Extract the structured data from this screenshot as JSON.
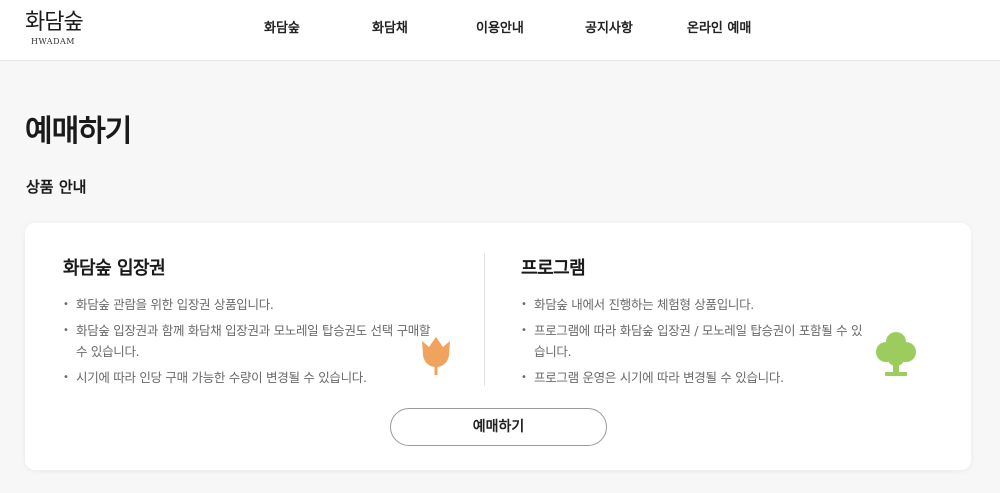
{
  "header": {
    "logo_main": "화담숲",
    "logo_sub": "HWADAM",
    "nav": [
      "화담숲",
      "화담채",
      "이용안내",
      "공지사항",
      "온라인 예매"
    ]
  },
  "page_title": "예매하기",
  "section_title": "상품 안내",
  "products": [
    {
      "title": "화담숲 입장권",
      "bullets": [
        "화담숲 관람을 위한 입장권 상품입니다.",
        "화담숲 입장권과 함께 화담채 입장권과 모노레일 탑승권도 선택 구매할 수 있습니다.",
        "시기에 따라 인당 구매 가능한 수량이 변경될 수 있습니다."
      ],
      "icon": "tulip-icon",
      "icon_color": "#f0a35e"
    },
    {
      "title": "프로그램",
      "bullets": [
        "화담숲 내에서 진행하는 체험형 상품입니다.",
        "프로그램에 따라 화담숲 입장권 / 모노레일 탑승권이 포함될 수 있습니다.",
        "프로그램 운영은 시기에 따라 변경될 수 있습니다."
      ],
      "icon": "tree-icon",
      "icon_color": "#9ccc5e"
    }
  ],
  "reserve_button": "예매하기"
}
